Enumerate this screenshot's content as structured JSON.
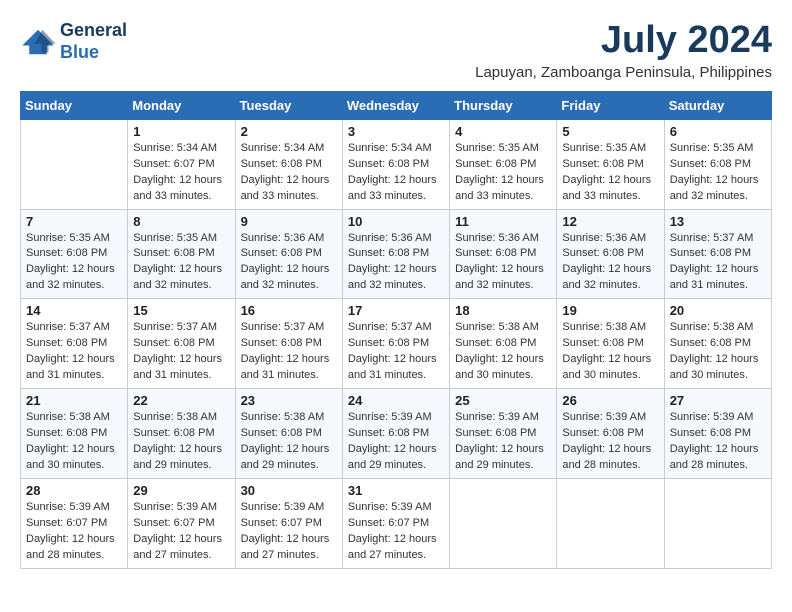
{
  "logo": {
    "line1": "General",
    "line2": "Blue"
  },
  "title": {
    "month_year": "July 2024",
    "location": "Lapuyan, Zamboanga Peninsula, Philippines"
  },
  "header_days": [
    "Sunday",
    "Monday",
    "Tuesday",
    "Wednesday",
    "Thursday",
    "Friday",
    "Saturday"
  ],
  "weeks": [
    [
      {
        "day": "",
        "sunrise": "",
        "sunset": "",
        "daylight": ""
      },
      {
        "day": "1",
        "sunrise": "Sunrise: 5:34 AM",
        "sunset": "Sunset: 6:07 PM",
        "daylight": "Daylight: 12 hours and 33 minutes."
      },
      {
        "day": "2",
        "sunrise": "Sunrise: 5:34 AM",
        "sunset": "Sunset: 6:08 PM",
        "daylight": "Daylight: 12 hours and 33 minutes."
      },
      {
        "day": "3",
        "sunrise": "Sunrise: 5:34 AM",
        "sunset": "Sunset: 6:08 PM",
        "daylight": "Daylight: 12 hours and 33 minutes."
      },
      {
        "day": "4",
        "sunrise": "Sunrise: 5:35 AM",
        "sunset": "Sunset: 6:08 PM",
        "daylight": "Daylight: 12 hours and 33 minutes."
      },
      {
        "day": "5",
        "sunrise": "Sunrise: 5:35 AM",
        "sunset": "Sunset: 6:08 PM",
        "daylight": "Daylight: 12 hours and 33 minutes."
      },
      {
        "day": "6",
        "sunrise": "Sunrise: 5:35 AM",
        "sunset": "Sunset: 6:08 PM",
        "daylight": "Daylight: 12 hours and 32 minutes."
      }
    ],
    [
      {
        "day": "7",
        "sunrise": "Sunrise: 5:35 AM",
        "sunset": "Sunset: 6:08 PM",
        "daylight": "Daylight: 12 hours and 32 minutes."
      },
      {
        "day": "8",
        "sunrise": "Sunrise: 5:35 AM",
        "sunset": "Sunset: 6:08 PM",
        "daylight": "Daylight: 12 hours and 32 minutes."
      },
      {
        "day": "9",
        "sunrise": "Sunrise: 5:36 AM",
        "sunset": "Sunset: 6:08 PM",
        "daylight": "Daylight: 12 hours and 32 minutes."
      },
      {
        "day": "10",
        "sunrise": "Sunrise: 5:36 AM",
        "sunset": "Sunset: 6:08 PM",
        "daylight": "Daylight: 12 hours and 32 minutes."
      },
      {
        "day": "11",
        "sunrise": "Sunrise: 5:36 AM",
        "sunset": "Sunset: 6:08 PM",
        "daylight": "Daylight: 12 hours and 32 minutes."
      },
      {
        "day": "12",
        "sunrise": "Sunrise: 5:36 AM",
        "sunset": "Sunset: 6:08 PM",
        "daylight": "Daylight: 12 hours and 32 minutes."
      },
      {
        "day": "13",
        "sunrise": "Sunrise: 5:37 AM",
        "sunset": "Sunset: 6:08 PM",
        "daylight": "Daylight: 12 hours and 31 minutes."
      }
    ],
    [
      {
        "day": "14",
        "sunrise": "Sunrise: 5:37 AM",
        "sunset": "Sunset: 6:08 PM",
        "daylight": "Daylight: 12 hours and 31 minutes."
      },
      {
        "day": "15",
        "sunrise": "Sunrise: 5:37 AM",
        "sunset": "Sunset: 6:08 PM",
        "daylight": "Daylight: 12 hours and 31 minutes."
      },
      {
        "day": "16",
        "sunrise": "Sunrise: 5:37 AM",
        "sunset": "Sunset: 6:08 PM",
        "daylight": "Daylight: 12 hours and 31 minutes."
      },
      {
        "day": "17",
        "sunrise": "Sunrise: 5:37 AM",
        "sunset": "Sunset: 6:08 PM",
        "daylight": "Daylight: 12 hours and 31 minutes."
      },
      {
        "day": "18",
        "sunrise": "Sunrise: 5:38 AM",
        "sunset": "Sunset: 6:08 PM",
        "daylight": "Daylight: 12 hours and 30 minutes."
      },
      {
        "day": "19",
        "sunrise": "Sunrise: 5:38 AM",
        "sunset": "Sunset: 6:08 PM",
        "daylight": "Daylight: 12 hours and 30 minutes."
      },
      {
        "day": "20",
        "sunrise": "Sunrise: 5:38 AM",
        "sunset": "Sunset: 6:08 PM",
        "daylight": "Daylight: 12 hours and 30 minutes."
      }
    ],
    [
      {
        "day": "21",
        "sunrise": "Sunrise: 5:38 AM",
        "sunset": "Sunset: 6:08 PM",
        "daylight": "Daylight: 12 hours and 30 minutes."
      },
      {
        "day": "22",
        "sunrise": "Sunrise: 5:38 AM",
        "sunset": "Sunset: 6:08 PM",
        "daylight": "Daylight: 12 hours and 29 minutes."
      },
      {
        "day": "23",
        "sunrise": "Sunrise: 5:38 AM",
        "sunset": "Sunset: 6:08 PM",
        "daylight": "Daylight: 12 hours and 29 minutes."
      },
      {
        "day": "24",
        "sunrise": "Sunrise: 5:39 AM",
        "sunset": "Sunset: 6:08 PM",
        "daylight": "Daylight: 12 hours and 29 minutes."
      },
      {
        "day": "25",
        "sunrise": "Sunrise: 5:39 AM",
        "sunset": "Sunset: 6:08 PM",
        "daylight": "Daylight: 12 hours and 29 minutes."
      },
      {
        "day": "26",
        "sunrise": "Sunrise: 5:39 AM",
        "sunset": "Sunset: 6:08 PM",
        "daylight": "Daylight: 12 hours and 28 minutes."
      },
      {
        "day": "27",
        "sunrise": "Sunrise: 5:39 AM",
        "sunset": "Sunset: 6:08 PM",
        "daylight": "Daylight: 12 hours and 28 minutes."
      }
    ],
    [
      {
        "day": "28",
        "sunrise": "Sunrise: 5:39 AM",
        "sunset": "Sunset: 6:07 PM",
        "daylight": "Daylight: 12 hours and 28 minutes."
      },
      {
        "day": "29",
        "sunrise": "Sunrise: 5:39 AM",
        "sunset": "Sunset: 6:07 PM",
        "daylight": "Daylight: 12 hours and 27 minutes."
      },
      {
        "day": "30",
        "sunrise": "Sunrise: 5:39 AM",
        "sunset": "Sunset: 6:07 PM",
        "daylight": "Daylight: 12 hours and 27 minutes."
      },
      {
        "day": "31",
        "sunrise": "Sunrise: 5:39 AM",
        "sunset": "Sunset: 6:07 PM",
        "daylight": "Daylight: 12 hours and 27 minutes."
      },
      {
        "day": "",
        "sunrise": "",
        "sunset": "",
        "daylight": ""
      },
      {
        "day": "",
        "sunrise": "",
        "sunset": "",
        "daylight": ""
      },
      {
        "day": "",
        "sunrise": "",
        "sunset": "",
        "daylight": ""
      }
    ]
  ]
}
